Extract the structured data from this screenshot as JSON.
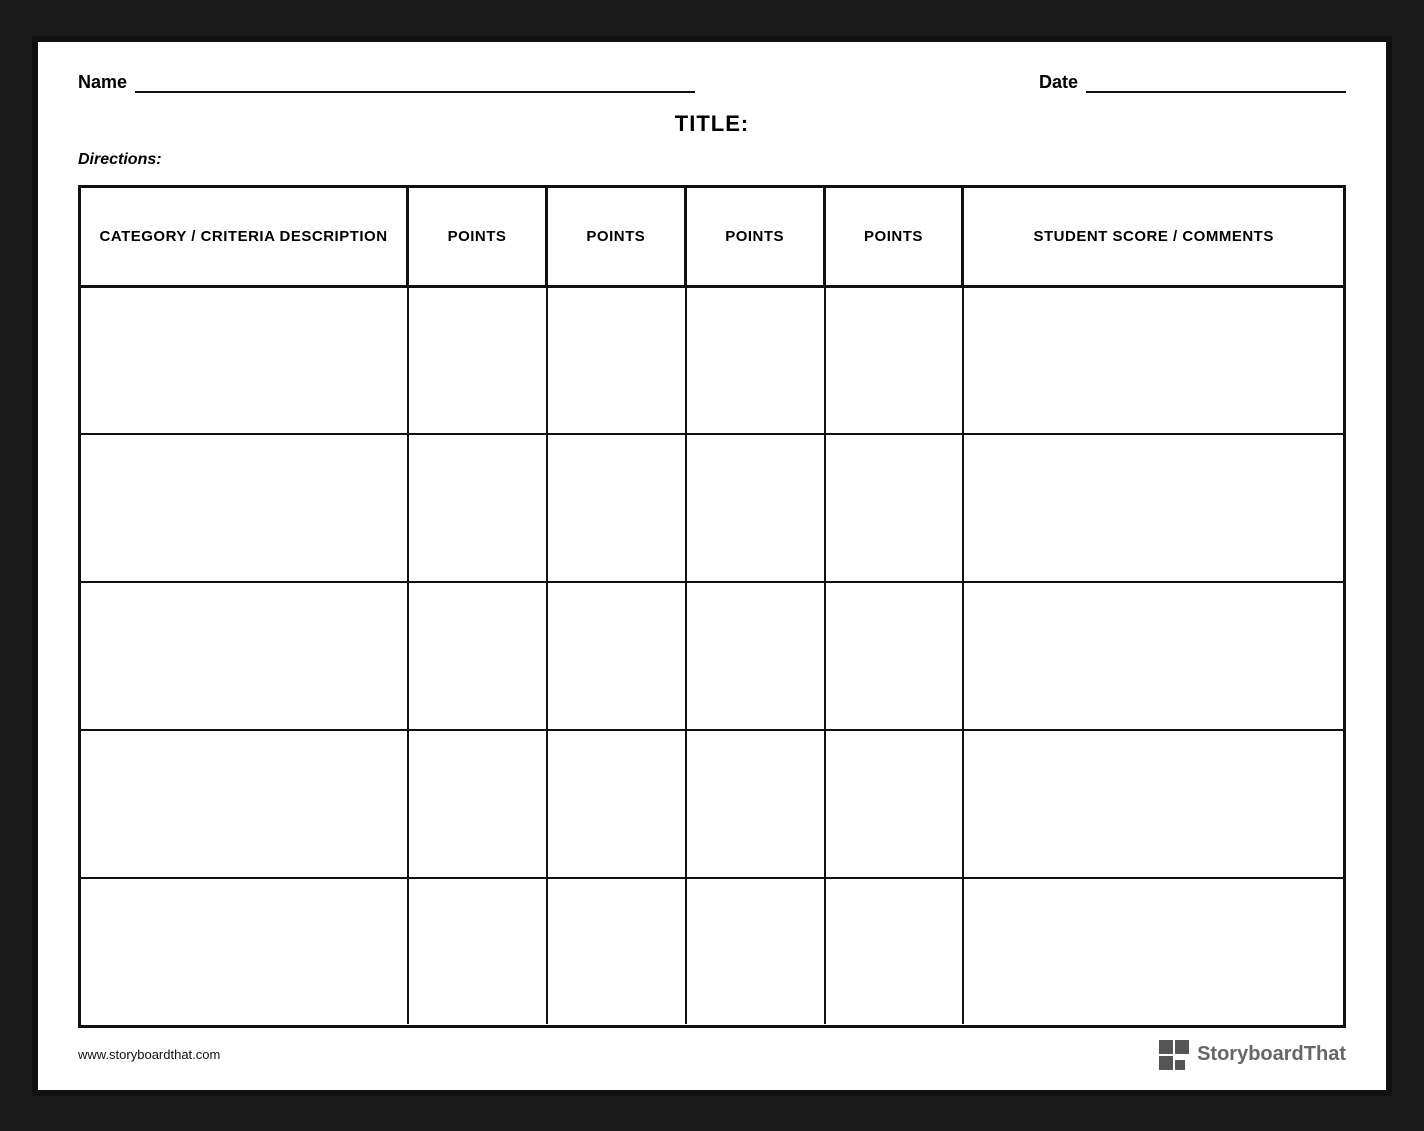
{
  "header": {
    "name_label": "Name",
    "date_label": "Date"
  },
  "title": {
    "text": "TITLE:"
  },
  "directions": {
    "label": "Directions:"
  },
  "table": {
    "columns": [
      {
        "key": "category",
        "label": "CATEGORY / CRITERIA DESCRIPTION"
      },
      {
        "key": "points1",
        "label": "POINTS"
      },
      {
        "key": "points2",
        "label": "POINTS"
      },
      {
        "key": "points3",
        "label": "POINTS"
      },
      {
        "key": "points4",
        "label": "POINTS"
      },
      {
        "key": "student",
        "label": "STUDENT SCORE / COMMENTS"
      }
    ],
    "row_count": 5
  },
  "footer": {
    "url": "www.storyboardthat.com",
    "brand": "StoryboardThat"
  }
}
